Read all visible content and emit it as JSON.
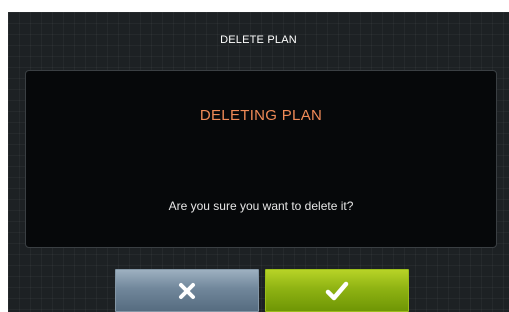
{
  "dialog": {
    "title": "DELETE PLAN",
    "heading": "DELETING PLAN",
    "message": "Are you sure you want to delete it?"
  },
  "buttons": {
    "cancel": {
      "icon": "close-icon",
      "color": "#71879b"
    },
    "confirm": {
      "icon": "checkmark-icon",
      "color": "#8fb313"
    }
  },
  "colors": {
    "background": "#1d2124",
    "panel": "#06080a",
    "heading": "#ef8a57",
    "text": "#ffffff"
  }
}
